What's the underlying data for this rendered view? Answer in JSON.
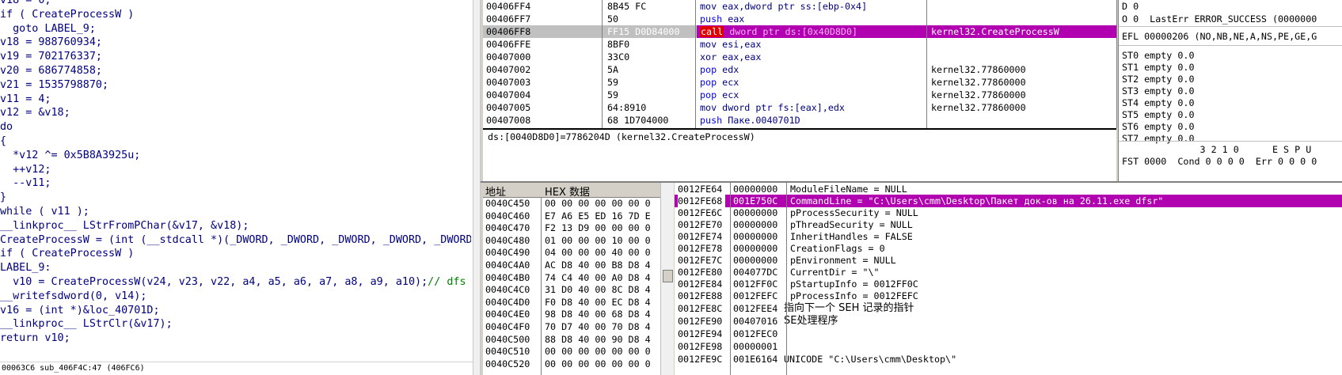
{
  "pseudocode": {
    "lines": [
      {
        "text": "v18 = 0;",
        "cls": "kw"
      },
      {
        "text": "if ( CreateProcessW )",
        "cls": "kw"
      },
      {
        "text": "  goto LABEL_9;",
        "cls": "kw"
      },
      {
        "text": "v18 = 988760934;",
        "cls": "kw"
      },
      {
        "text": "v19 = 702176337;",
        "cls": "kw"
      },
      {
        "text": "v20 = 686774858;",
        "cls": "kw"
      },
      {
        "text": "v21 = 1535798870;",
        "cls": "kw"
      },
      {
        "text": "v11 = 4;",
        "cls": "kw"
      },
      {
        "text": "v12 = &v18;",
        "cls": "kw"
      },
      {
        "text": "do",
        "cls": "kw"
      },
      {
        "text": "{",
        "cls": "kw"
      },
      {
        "text": "  *v12 ^= 0x5B8A3925u;",
        "cls": "kw"
      },
      {
        "text": "  ++v12;",
        "cls": "kw"
      },
      {
        "text": "  --v11;",
        "cls": "kw"
      },
      {
        "text": "}",
        "cls": "kw"
      },
      {
        "text": "while ( v11 );",
        "cls": "kw"
      },
      {
        "text": "__linkproc__ LStrFromPChar(&v17, &v18);",
        "cls": "kw"
      },
      {
        "text": "CreateProcessW = (int (__stdcall *)(_DWORD, _DWORD, _DWORD, _DWORD, _DWORD",
        "cls": "kw"
      },
      {
        "text": "if ( CreateProcessW )",
        "cls": "kw"
      },
      {
        "text": "LABEL_9:",
        "cls": "kw"
      },
      {
        "text": "  v10 = CreateProcessW(v24, v23, v22, a4, a5, a6, a7, a8, a9, a10);",
        "cls": "kw",
        "comment": "// dfs"
      },
      {
        "text": "__writefsdword(0, v14);",
        "cls": "kw"
      },
      {
        "text": "v16 = (int *)&loc_40701D;",
        "cls": "kw"
      },
      {
        "text": "__linkproc__ LStrClr(&v17);",
        "cls": "kw"
      },
      {
        "text": "return v10;",
        "cls": "kw"
      }
    ],
    "status": "00063C6 sub_406F4C:47 (406FC6)"
  },
  "disasm": [
    {
      "addr": "00406FF4",
      "hex": "8B45 FC",
      "mn": "mov",
      "ops": "eax,dword ptr ss:[ebp-0x4]",
      "cmt": ""
    },
    {
      "addr": "00406FF7",
      "hex": "50",
      "mn": "push",
      "ops": "eax",
      "cmt": ""
    },
    {
      "addr": "00406FF8",
      "hex": "FF15 D0D84000",
      "mn": "call",
      "ops": "dword ptr ds:[0x40D8D0]",
      "cmt": "kernel32.CreateProcessW",
      "selected": true
    },
    {
      "addr": "00406FFE",
      "hex": "8BF0",
      "mn": "mov",
      "ops": "esi,eax",
      "cmt": ""
    },
    {
      "addr": "00407000",
      "hex": "33C0",
      "mn": "xor",
      "ops": "eax,eax",
      "cmt": ""
    },
    {
      "addr": "00407002",
      "hex": "5A",
      "mn": "pop",
      "ops": "edx",
      "cmt": "kernel32.77860000"
    },
    {
      "addr": "00407003",
      "hex": "59",
      "mn": "pop",
      "ops": "ecx",
      "cmt": "kernel32.77860000"
    },
    {
      "addr": "00407004",
      "hex": "59",
      "mn": "pop",
      "ops": "ecx",
      "cmt": "kernel32.77860000"
    },
    {
      "addr": "00407005",
      "hex": "64:8910",
      "mn": "mov",
      "ops": "dword ptr fs:[eax],edx",
      "cmt": "kernel32.77860000"
    },
    {
      "addr": "00407008",
      "hex": "68 1D704000",
      "mn": "push",
      "ops": "Пакe.0040701D",
      "cmt": ""
    }
  ],
  "info": "ds:[0040D8D0]=7786204D (kernel32.CreateProcessW)",
  "registers": [
    "D 0",
    "O 0  LastErr ERROR_SUCCESS (0000000",
    "EFL 00000206 (NO,NB,NE,A,NS,PE,GE,G",
    "ST0 empty 0.0",
    "ST1 empty 0.0",
    "ST2 empty 0.0",
    "ST3 empty 0.0",
    "ST4 empty 0.0",
    "ST5 empty 0.0",
    "ST6 empty 0.0",
    "ST7 empty 0.0",
    "              3 2 1 0      E S P U",
    "FST 0000  Cond 0 0 0 0  Err 0 0 0 0"
  ],
  "dump": {
    "header_addr": "地址",
    "header_hex": "HEX 数据",
    "rows": [
      {
        "a": "0040C450",
        "b": "00 00 00 00 00 00 0"
      },
      {
        "a": "0040C460",
        "b": "E7 A6 E5 ED 16 7D E"
      },
      {
        "a": "0040C470",
        "b": "F2 13 D9 00 00 00 0"
      },
      {
        "a": "0040C480",
        "b": "01 00 00 00 10 00 0"
      },
      {
        "a": "0040C490",
        "b": "04 00 00 00 40 00 0"
      },
      {
        "a": "0040C4A0",
        "b": "AC D8 40 00 B8 D8 4"
      },
      {
        "a": "0040C4B0",
        "b": "74 C4 40 00 A0 D8 4"
      },
      {
        "a": "0040C4C0",
        "b": "31 D0 40 00 8C D8 4"
      },
      {
        "a": "0040C4D0",
        "b": "F0 D8 40 00 EC D8 4"
      },
      {
        "a": "0040C4E0",
        "b": "98 D8 40 00 68 D8 4"
      },
      {
        "a": "0040C4F0",
        "b": "70 D7 40 00 70 D8 4"
      },
      {
        "a": "0040C500",
        "b": "88 D8 40 00 90 D8 4"
      },
      {
        "a": "0040C510",
        "b": "00 00 00 00 00 00 0"
      },
      {
        "a": "0040C520",
        "b": "00 00 00 00 00 00 0"
      }
    ]
  },
  "stack": [
    {
      "a": "0012FE64",
      "v": "00000000",
      "c": "ModuleFileName = NULL"
    },
    {
      "a": "0012FE68",
      "v": "001E750C",
      "c": "CommandLine = \"C:\\Users\\cmm\\Desktop\\Пакет док-ов на 26.11.exe dfsr\"",
      "selected": true
    },
    {
      "a": "0012FE6C",
      "v": "00000000",
      "c": "pProcessSecurity = NULL"
    },
    {
      "a": "0012FE70",
      "v": "00000000",
      "c": "pThreadSecurity = NULL"
    },
    {
      "a": "0012FE74",
      "v": "00000000",
      "c": "InheritHandles = FALSE"
    },
    {
      "a": "0012FE78",
      "v": "00000000",
      "c": "CreationFlags = 0"
    },
    {
      "a": "0012FE7C",
      "v": "00000000",
      "c": "pEnvironment = NULL"
    },
    {
      "a": "0012FE80",
      "v": "004077DC",
      "c": "CurrentDir = \"\\\""
    },
    {
      "a": "0012FE84",
      "v": "0012FF0C",
      "c": "pStartupInfo = 0012FF0C"
    },
    {
      "a": "0012FE88",
      "v": "0012FEFC",
      "c": "pProcessInfo = 0012FEFC"
    },
    {
      "a": "0012FE8C",
      "v": "0012FEE4",
      "c": "指向下一个 SEH 记录的指针",
      "cjk": true,
      "wide": true
    },
    {
      "a": "0012FE90",
      "v": "00407016",
      "c": "SE处理程序",
      "cjk": true,
      "wide": true
    },
    {
      "a": "0012FE94",
      "v": "0012FEC0",
      "c": ""
    },
    {
      "a": "0012FE98",
      "v": "00000001",
      "c": ""
    },
    {
      "a": "0012FE9C",
      "v": "001E6164",
      "c": "UNICODE \"C:\\Users\\cmm\\Desktop\\\"",
      "wide": true
    }
  ]
}
